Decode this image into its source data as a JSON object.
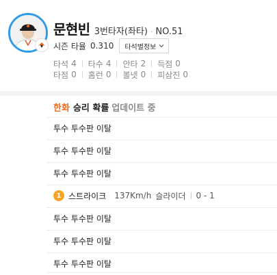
{
  "player": {
    "name": "문현빈",
    "order": "3번타자(좌타)",
    "dot": "·",
    "number": "NO.51",
    "season_label": "시즌 타율",
    "season_avg": "0.310",
    "dropdown_label": "타석별정보"
  },
  "stats": [
    [
      {
        "label": "타석",
        "value": "4"
      },
      {
        "label": "타수",
        "value": "4"
      },
      {
        "label": "안타",
        "value": "2"
      },
      {
        "label": "득점",
        "value": "0"
      }
    ],
    [
      {
        "label": "타점",
        "value": "0"
      },
      {
        "label": "홈런",
        "value": "0"
      },
      {
        "label": "볼넷",
        "value": "0"
      },
      {
        "label": "피삼진",
        "value": "0"
      }
    ]
  ],
  "win_prob": {
    "team": "한화",
    "text": "승리 확률",
    "status": "업데이트 중"
  },
  "events": [
    {
      "text": "투수 투수판 이탈"
    },
    {
      "text": "투수 투수판 이탈"
    },
    {
      "text": "투수 투수판 이탈"
    },
    {
      "pitch_no": "1",
      "result": "스트라이크",
      "speed": "137Km/h",
      "type": "슬라이더",
      "count": "0 - 1"
    },
    {
      "text": "투수 투수판 이탈"
    },
    {
      "text": "투수 투수판 이탈"
    },
    {
      "text": "투수 투수판 이탈"
    }
  ],
  "colors": {
    "accent_orange": "#ec6b1b",
    "badge_orange": "#f5a623",
    "avatar_ring": "#2f9be6"
  },
  "icons": {
    "dropdown": "chevron-down-icon",
    "team_logo": "eagles-logo-icon"
  }
}
